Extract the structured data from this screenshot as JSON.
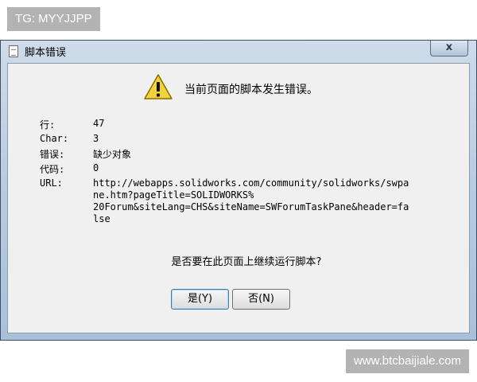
{
  "watermark_top": "TG: MYYJJPP",
  "watermark_bottom": "www.btcbaijiale.com",
  "dialog": {
    "title": "脚本错误",
    "close_glyph": "x",
    "message": "当前页面的脚本发生错误。",
    "fields": [
      {
        "label": "行:",
        "value": "47"
      },
      {
        "label": "Char:",
        "value": "3"
      },
      {
        "label": "错误:",
        "value": "缺少对象"
      },
      {
        "label": "代码:",
        "value": "0"
      },
      {
        "label": "URL:",
        "value": "http://webapps.solidworks.com/community/solidworks/swpa\nne.htm?pageTitle=SOLIDWORKS%\n20Forum&siteLang=CHS&siteName=SWForumTaskPane&header=fa\nlse"
      }
    ],
    "question": "是否要在此页面上继续运行脚本?",
    "yes_label": "是(Y)",
    "no_label": "否(N)"
  },
  "icons": {
    "title": "document-icon",
    "warning": "warning-icon"
  },
  "colors": {
    "warning_fill": "#f2d33a",
    "watermark_bg": "#b3b3b3"
  }
}
